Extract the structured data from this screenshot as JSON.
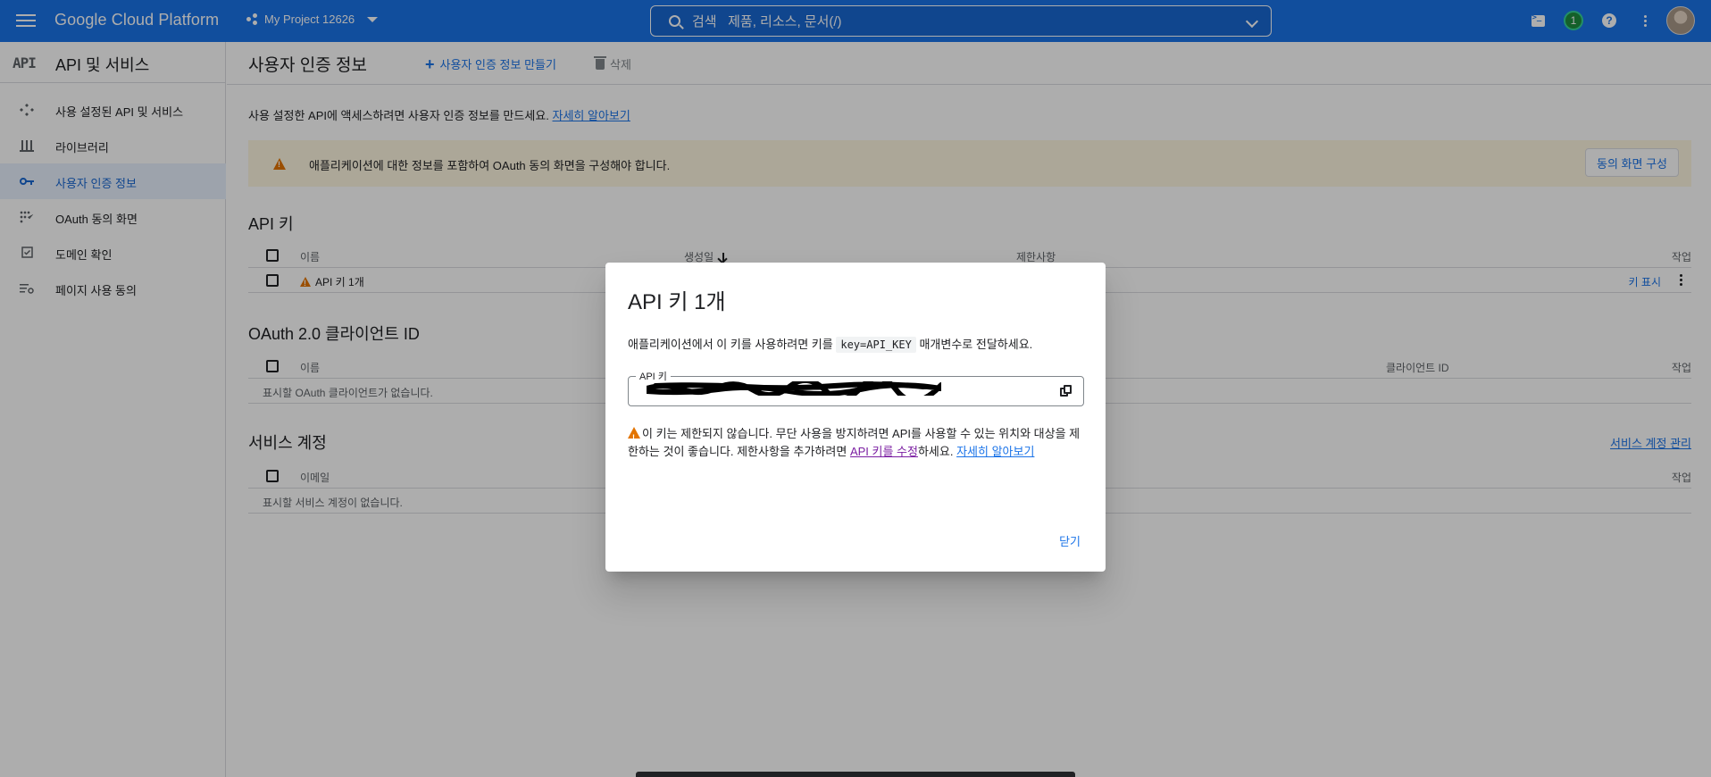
{
  "topbar": {
    "brand": "Google Cloud Platform",
    "project": "My Project 12626",
    "search_placeholder": "검색   제품, 리소스, 문서(/)",
    "notification_count": "1",
    "help_label": "?"
  },
  "sidebar": {
    "logo": "API",
    "title": "API 및 서비스",
    "items": [
      {
        "label": "사용 설정된 API 및 서비스",
        "icon": "apis-icon"
      },
      {
        "label": "라이브러리",
        "icon": "library-icon"
      },
      {
        "label": "사용자 인증 정보",
        "icon": "key-icon",
        "active": true
      },
      {
        "label": "OAuth 동의 화면",
        "icon": "consent-icon"
      },
      {
        "label": "도메인 확인",
        "icon": "checkbox-icon"
      },
      {
        "label": "페이지 사용 동의",
        "icon": "settings-list-icon"
      }
    ]
  },
  "main": {
    "title": "사용자 인증 정보",
    "create_label": "사용자 인증 정보 만들기",
    "delete_label": "삭제",
    "intro_text": "사용 설정한 API에 액세스하려면 사용자 인증 정보를 만드세요.",
    "intro_link": "자세히 알아보기",
    "warning_text": "애플리케이션에 대한 정보를 포함하여 OAuth 동의 화면을 구성해야 합니다.",
    "consent_button": "동의 화면 구성",
    "api_keys": {
      "title": "API 키",
      "columns": {
        "name": "이름",
        "created": "생성일",
        "restrictions": "제한사항",
        "actions": "작업"
      },
      "rows": [
        {
          "name": "API 키 1개",
          "action": "키 표시"
        }
      ]
    },
    "oauth": {
      "title": "OAuth 2.0 클라이언트 ID",
      "columns": {
        "name": "이름",
        "client_id": "클라이언트 ID",
        "actions": "작업"
      },
      "empty": "표시할 OAuth 클라이언트가 없습니다."
    },
    "service_accounts": {
      "title": "서비스 계정",
      "manage_link": "서비스 계정 관리",
      "columns": {
        "email": "이메일",
        "actions": "작업"
      },
      "empty": "표시할 서비스 계정이 없습니다."
    }
  },
  "dialog": {
    "title": "API 키 1개",
    "desc_before": "애플리케이션에서 이 키를 사용하려면 키를",
    "desc_code": "key=API_KEY",
    "desc_after": "매개변수로 전달하세요.",
    "field_label": "API 키",
    "field_value": "",
    "warn_text": "이 키는 제한되지 않습니다. 무단 사용을 방지하려면 API를 사용할 수 있는 위치와 대상을 제한하는 것이 좋습니다. 제한사항을 추가하려면",
    "warn_link1": "API 키를 수정",
    "warn_mid": "하세요.",
    "warn_link2": "자세히 알아보기",
    "close_label": "닫기"
  },
  "colors": {
    "brand_blue": "#1a73e8",
    "warning_orange": "#e37400",
    "active_bg": "#e8f0fe"
  }
}
